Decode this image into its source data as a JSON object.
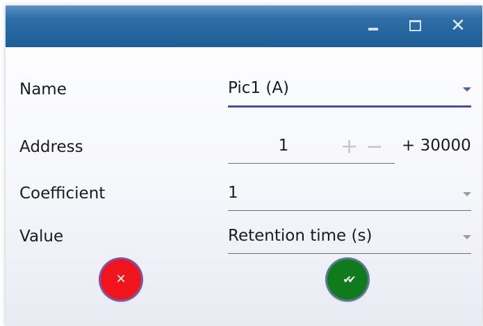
{
  "window": {
    "controls": {
      "minimize_icon": "minimize-icon",
      "maximize_icon": "maximize-icon",
      "close_icon": "close-icon",
      "close_glyph": "✕"
    },
    "accent_color": "#1d5e98"
  },
  "form": {
    "name": {
      "label": "Name",
      "value": "Pic1 (A)"
    },
    "address": {
      "label": "Address",
      "value": "1",
      "plus": "+",
      "minus": "−",
      "suffix": "+ 30000"
    },
    "coefficient": {
      "label": "Coefficient",
      "value": "1"
    },
    "value": {
      "label": "Value",
      "value": "Retention time (s)"
    }
  },
  "buttons": {
    "cancel": {
      "glyph": "✕",
      "color": "#f0141c",
      "icon": "x-icon"
    },
    "confirm": {
      "glyph": "✔✔",
      "color": "#0f7b1d",
      "icon": "double-check-icon"
    }
  }
}
